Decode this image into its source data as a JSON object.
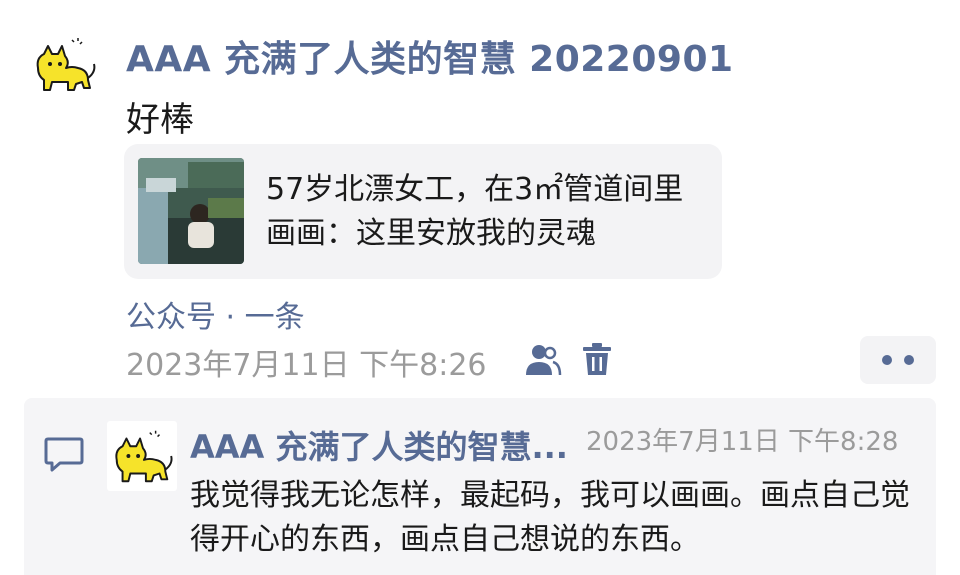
{
  "post": {
    "author": "AAA 充满了人类的智慧 20220901",
    "avatar_icon": "yellow-cat-icon",
    "message": "好棒",
    "link_card": {
      "title": "57岁北漂女工，在3㎡管道间里画画：这里安放我的灵魂",
      "thumbnail_icon": "article-thumbnail"
    },
    "source": "公众号 · 一条",
    "timestamp": "2023年7月11日 下午8:26",
    "actions": {
      "visibility_icon": "people-icon",
      "delete_icon": "trash-icon",
      "more_icon": "more-dots-icon"
    }
  },
  "comment": {
    "comment_icon": "comment-icon",
    "author": "AAA 充满了人类的智慧...",
    "timestamp": "2023年7月11日 下午8:28",
    "text": "我觉得我无论怎样，最起码，我可以画画。画点自己觉得开心的东西，画点自己想说的东西。"
  },
  "colors": {
    "link_blue": "#576b95",
    "time_gray": "#9b9b9b",
    "card_bg": "#f3f3f5"
  }
}
